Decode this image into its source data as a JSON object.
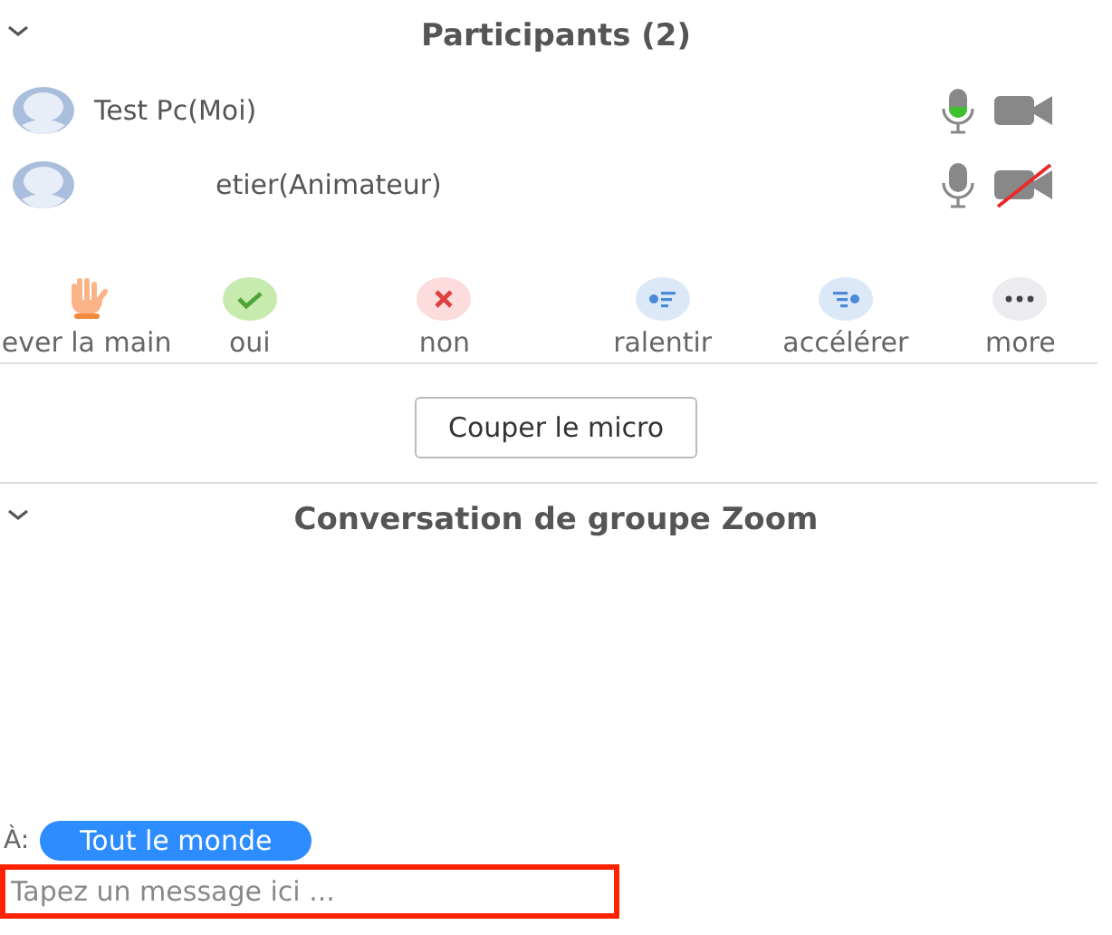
{
  "participants": {
    "title": "Participants (2)",
    "expanded": true,
    "items": [
      {
        "name": "Test Pc(Moi)",
        "redacted": false,
        "mic_active": true,
        "video_on": true
      },
      {
        "name": "etier(Animateur)",
        "redacted": true,
        "mic_active": false,
        "video_on": false
      }
    ]
  },
  "reactions": [
    {
      "kind": "hand",
      "label": "ever la main"
    },
    {
      "kind": "yes",
      "label": "oui"
    },
    {
      "kind": "no",
      "label": "non"
    },
    {
      "kind": "slower",
      "label": "ralentir"
    },
    {
      "kind": "faster",
      "label": "accélérer"
    },
    {
      "kind": "more",
      "label": "more"
    }
  ],
  "mute_button": "Couper le micro",
  "chat": {
    "title": "Conversation de groupe Zoom",
    "expanded": true,
    "to_label": "À:",
    "recipient": "Tout le monde",
    "placeholder": "Tapez un message ici ..."
  }
}
